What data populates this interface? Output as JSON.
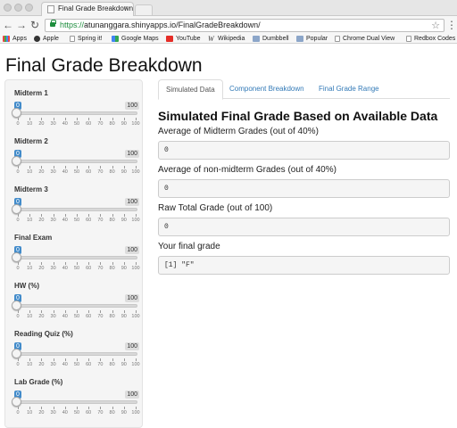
{
  "browser": {
    "tab_title": "Final Grade Breakdown",
    "url_scheme": "https://",
    "url_rest": "atunanggara.shinyapps.io/FinalGradeBreakdown/",
    "bookmarks": [
      {
        "label": "Apps",
        "icon": "apps-grid-icon"
      },
      {
        "label": "Apple",
        "icon": "apple-icon"
      },
      {
        "label": "Spring it!",
        "icon": "page-icon"
      },
      {
        "label": "Google Maps",
        "icon": "maps-icon"
      },
      {
        "label": "YouTube",
        "icon": "youtube-icon"
      },
      {
        "label": "Wikipedia",
        "icon": "wikipedia-icon"
      },
      {
        "label": "Dumbbell",
        "icon": "folder-icon"
      },
      {
        "label": "Popular",
        "icon": "folder-icon"
      },
      {
        "label": "Chrome Dual View",
        "icon": "page-icon"
      },
      {
        "label": "Redbox Codes",
        "icon": "page-icon"
      }
    ]
  },
  "page": {
    "title": "Final Grade Breakdown"
  },
  "sidebar": {
    "sliders": [
      {
        "label": "Midterm 1",
        "value": 0,
        "min": 0,
        "max": 100
      },
      {
        "label": "Midterm 2",
        "value": 0,
        "min": 0,
        "max": 100
      },
      {
        "label": "Midterm 3",
        "value": 0,
        "min": 0,
        "max": 100
      },
      {
        "label": "Final Exam",
        "value": 0,
        "min": 0,
        "max": 100
      },
      {
        "label": "HW (%)",
        "value": 0,
        "min": 0,
        "max": 100
      },
      {
        "label": "Reading Quiz (%)",
        "value": 0,
        "min": 0,
        "max": 100
      },
      {
        "label": "Lab Grade (%)",
        "value": 0,
        "min": 0,
        "max": 100
      }
    ],
    "tick_labels": [
      "0",
      "10",
      "20",
      "30",
      "40",
      "50",
      "60",
      "70",
      "80",
      "90",
      "100"
    ]
  },
  "tabs": [
    {
      "label": "Simulated Data",
      "active": true
    },
    {
      "label": "Component Breakdown",
      "active": false
    },
    {
      "label": "Final Grade Range",
      "active": false
    }
  ],
  "main": {
    "heading": "Simulated Final Grade Based on Available Data",
    "outputs": [
      {
        "label": "Average of Midterm Grades (out of 40%)",
        "value": "0"
      },
      {
        "label": "Average of non-midterm Grades (out of 40%)",
        "value": "0"
      },
      {
        "label": "Raw Total Grade (out of 100)",
        "value": "0"
      },
      {
        "label": "Your final grade",
        "value": "[1] \"F\""
      }
    ]
  },
  "colors": {
    "accent": "#428bca",
    "link": "#337ab7"
  }
}
